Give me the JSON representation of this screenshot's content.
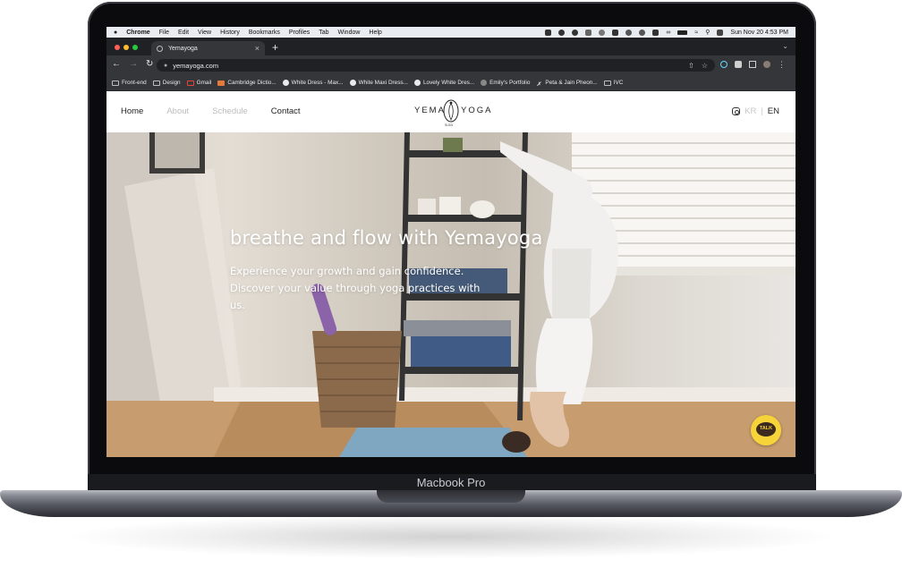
{
  "device": {
    "model_label": "Macbook Pro"
  },
  "menubar": {
    "app_name": "Chrome",
    "items": [
      "File",
      "Edit",
      "View",
      "History",
      "Bookmarks",
      "Profiles",
      "Tab",
      "Window",
      "Help"
    ],
    "clock": "Sun Nov 20  4:53 PM"
  },
  "browser": {
    "tab_title": "Yemayoga",
    "tab_close": "×",
    "new_tab": "+",
    "url": "yemayoga.com",
    "bookmarks": [
      {
        "label": "Front-end",
        "icon": "folder-icon"
      },
      {
        "label": "Design",
        "icon": "folder-icon"
      },
      {
        "label": "Gmail",
        "icon": "gmail-icon"
      },
      {
        "label": "Cambridge Dictio...",
        "icon": "cambridge-icon"
      },
      {
        "label": "White Dress - Max...",
        "icon": "site-icon"
      },
      {
        "label": "White Maxi Dress...",
        "icon": "site-icon"
      },
      {
        "label": "Lovely White Dres...",
        "icon": "site-icon"
      },
      {
        "label": "Emily's Portfolio",
        "icon": "globe-icon"
      },
      {
        "label": "Peta & Jain Pheon...",
        "icon": "site-icon"
      },
      {
        "label": "IVC",
        "icon": "folder-icon"
      }
    ]
  },
  "site": {
    "nav": {
      "home": "Home",
      "about": "About",
      "schedule": "Schedule",
      "contact": "Contact"
    },
    "logo": {
      "left": "YEMA",
      "right": "YOGA",
      "sub": "sura"
    },
    "lang": {
      "kr": "KR",
      "sep": "|",
      "en": "EN"
    },
    "hero": {
      "title": "breathe and flow with Yemayoga",
      "subtitle": "Experience your growth and gain confidence. Discover your value through yoga practices with us."
    },
    "chat_button": "TALK"
  },
  "colors": {
    "menubar_bg": "#e9ecf0",
    "tabbar_bg": "#202124",
    "toolbar_bg": "#35363a",
    "talk_yellow": "#f7d33a",
    "nav_active": "#222222",
    "nav_dim": "#bdbdbd"
  }
}
